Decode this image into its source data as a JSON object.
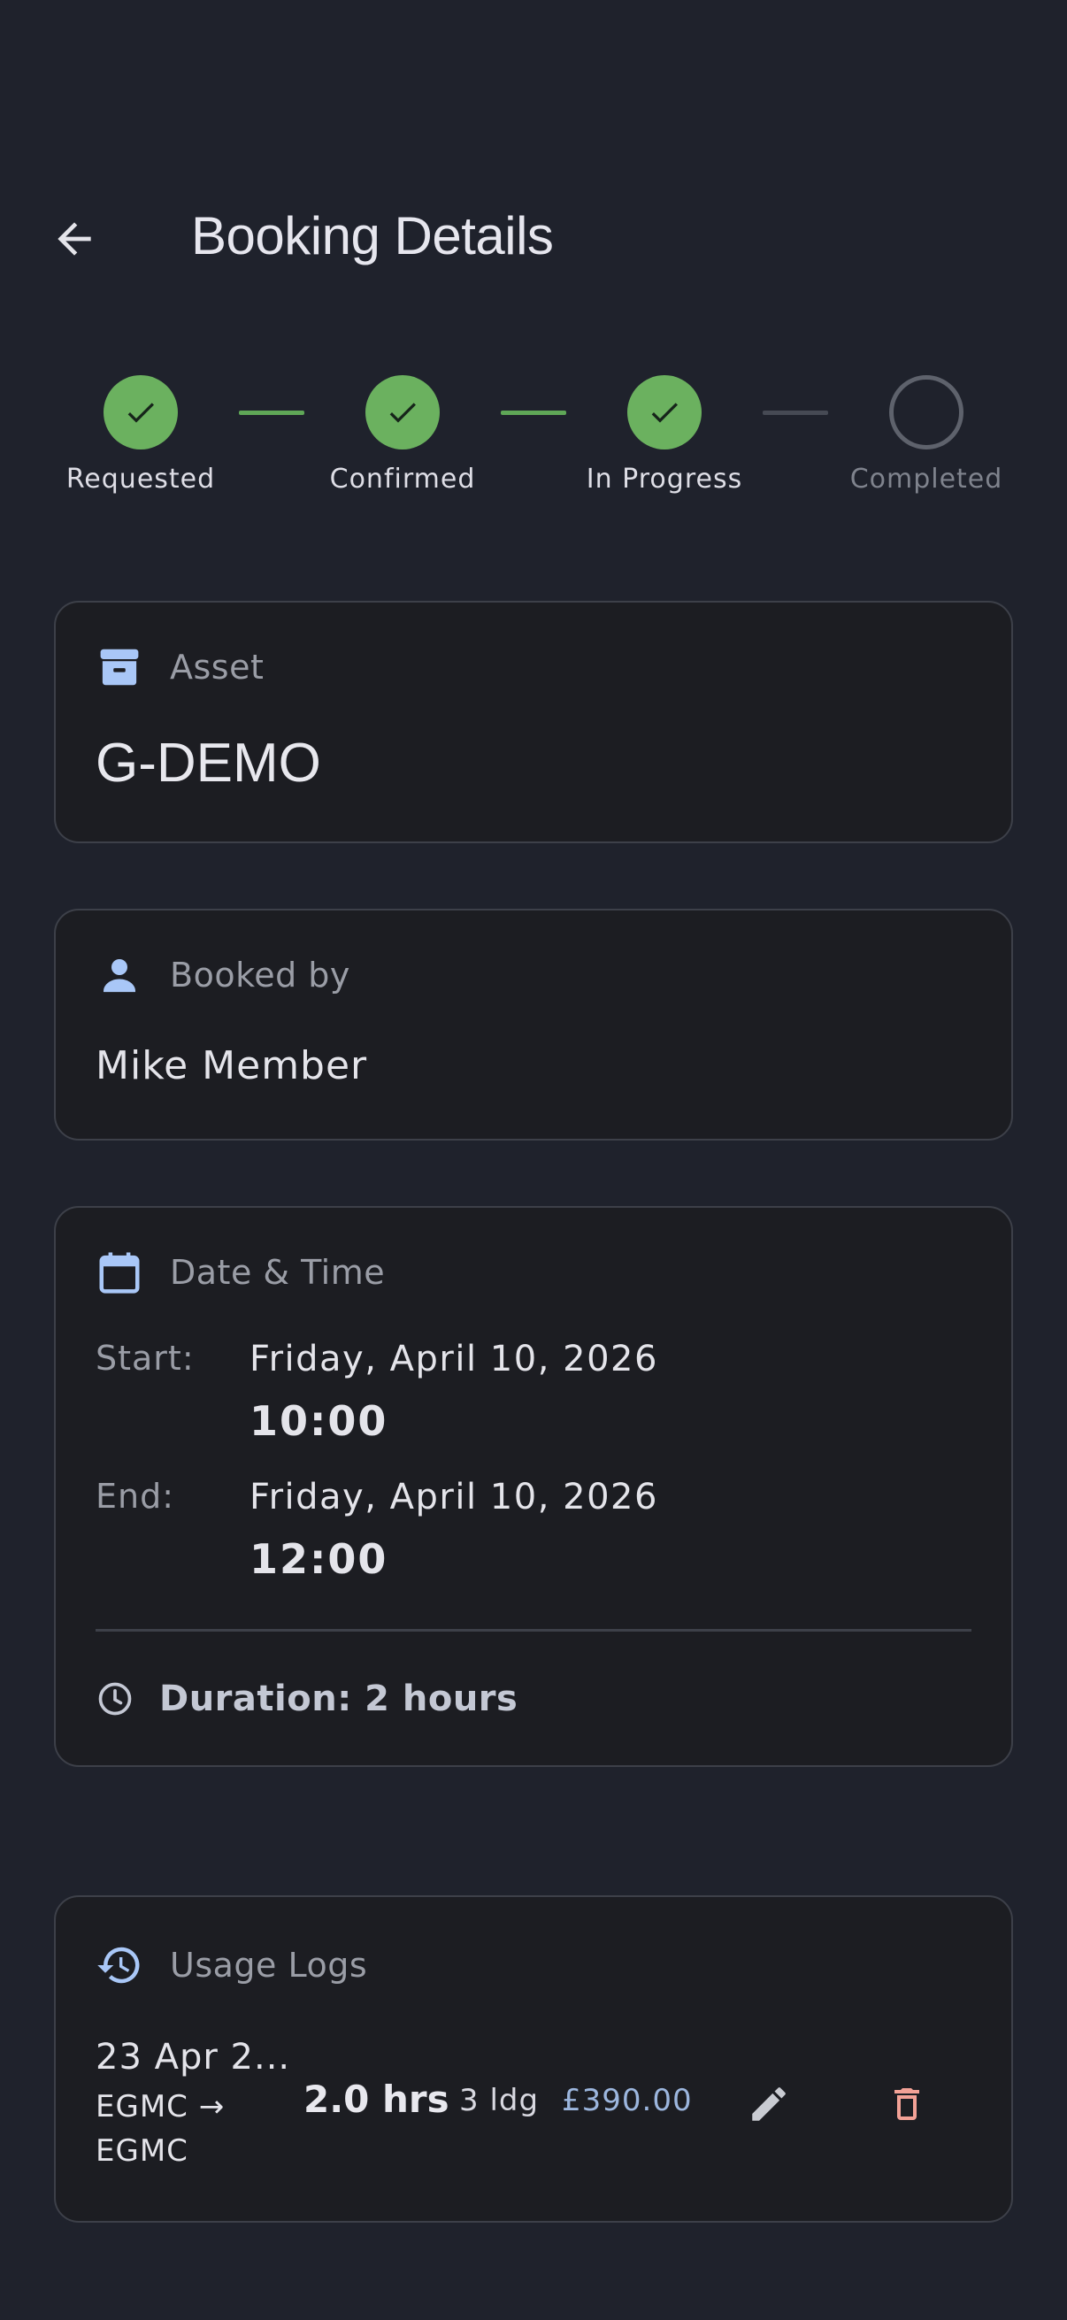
{
  "header": {
    "title": "Booking Details"
  },
  "stepper": {
    "steps": [
      {
        "label": "Requested",
        "state": "done"
      },
      {
        "label": "Confirmed",
        "state": "done"
      },
      {
        "label": "In Progress",
        "state": "done"
      },
      {
        "label": "Completed",
        "state": "pending"
      }
    ]
  },
  "asset": {
    "label": "Asset",
    "value": "G-DEMO"
  },
  "booked_by": {
    "label": "Booked by",
    "value": "Mike Member"
  },
  "date_time": {
    "label": "Date & Time",
    "start": {
      "key": "Start:",
      "date": "Friday, April 10, 2026",
      "time": "10:00"
    },
    "end": {
      "key": "End:",
      "date": "Friday, April 10, 2026",
      "time": "12:00"
    },
    "duration": "Duration: 2 hours"
  },
  "usage_logs": {
    "label": "Usage Logs",
    "entries": [
      {
        "date": "23 Apr 2...",
        "route": "EGMC → EGMC",
        "hours": "2.0 hrs",
        "landings": "3 ldg",
        "price": "£390.00"
      }
    ]
  },
  "colors": {
    "background": "#1f222c",
    "card": "#1c1d22",
    "step_done": "#6bb15f",
    "accent_icon": "#a9c7f7",
    "price": "#9cb6de",
    "delete": "#f2a196"
  }
}
